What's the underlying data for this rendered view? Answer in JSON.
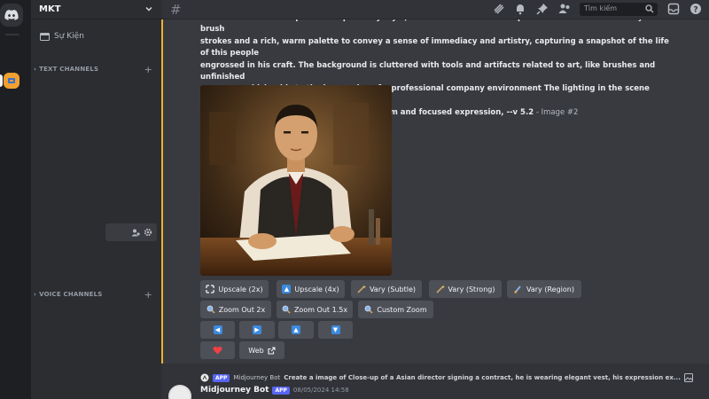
{
  "server": {
    "name": "MKT"
  },
  "sidebar": {
    "events_label": "Sự Kiện",
    "categories": [
      {
        "label": "TEXT CHANNELS"
      },
      {
        "label": "VOICE CHANNELS"
      }
    ]
  },
  "topbar": {
    "search_placeholder": "Tìm kiếm"
  },
  "message": {
    "text_lines": [
      "worried and scared depicted in a painterly style, reminiscent of classic oil portraits.the artwork uses dynamic brush",
      "strokes and a rich, warm palette to convey a sense of immediacy and artistry, capturing a snapshot of the life of this people",
      "engrossed in his craft. The background is cluttered with tools and artifacts related to art, like brushes and unfinished",
      "canvases, which adds to the impression of a professional company environment The lighting in the scene highlights his face",
      "and upper body, drawing attention to his calm and focused expression, --v 5.2"
    ],
    "suffix": " - Image #2",
    "buttons": {
      "upscale_2x": "Upscale (2x)",
      "upscale_4x": "Upscale (4x)",
      "vary_subtle": "Vary (Subtle)",
      "vary_strong": "Vary (Strong)",
      "vary_region": "Vary (Region)",
      "zoom_out_2x": "Zoom Out 2x",
      "zoom_out_15x": "Zoom Out 1.5x",
      "custom_zoom": "Custom Zoom",
      "web": "Web"
    }
  },
  "next_message": {
    "reply_author": "Midjourney Bot",
    "reply_text": "Create a image of Close-up of a Asian director signing a contract, he is wearing elegant vest, his expression ex...",
    "author": "Midjourney Bot",
    "badge": "APP",
    "timestamp": "08/05/2024 14:58"
  },
  "colors": {
    "accent_highlight": "#f0b232",
    "blurple": "#5865f2",
    "heart": "#f23f43",
    "arrow_blue": "#3b8ae0"
  }
}
